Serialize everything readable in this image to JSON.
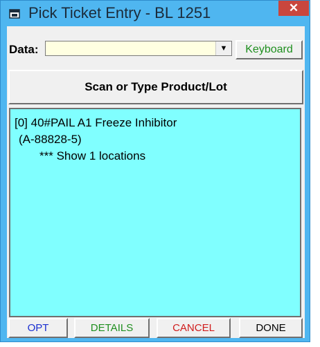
{
  "window": {
    "title": "Pick Ticket Entry - BL 1251",
    "close_label": "✕"
  },
  "data_field": {
    "label": "Data:",
    "value": ""
  },
  "buttons": {
    "keyboard": "Keyboard",
    "scan": "Scan or Type Product/Lot",
    "opt": "OPT",
    "details": "DETAILS",
    "cancel": "CANCEL",
    "done": "DONE"
  },
  "list": {
    "items": [
      {
        "line1": "[0] 40#PAIL A1 Freeze Inhibitor",
        "line2": "(A-88828-5)",
        "line3": "*** Show 1 locations"
      }
    ]
  },
  "colors": {
    "titlebar": "#4fb6f0",
    "list_background": "#80ffff",
    "input_background": "#ffffe1",
    "close_button": "#c9463d"
  },
  "icons": {
    "app": "app-window-icon",
    "close": "close-icon",
    "dropdown": "chevron-down-icon"
  }
}
